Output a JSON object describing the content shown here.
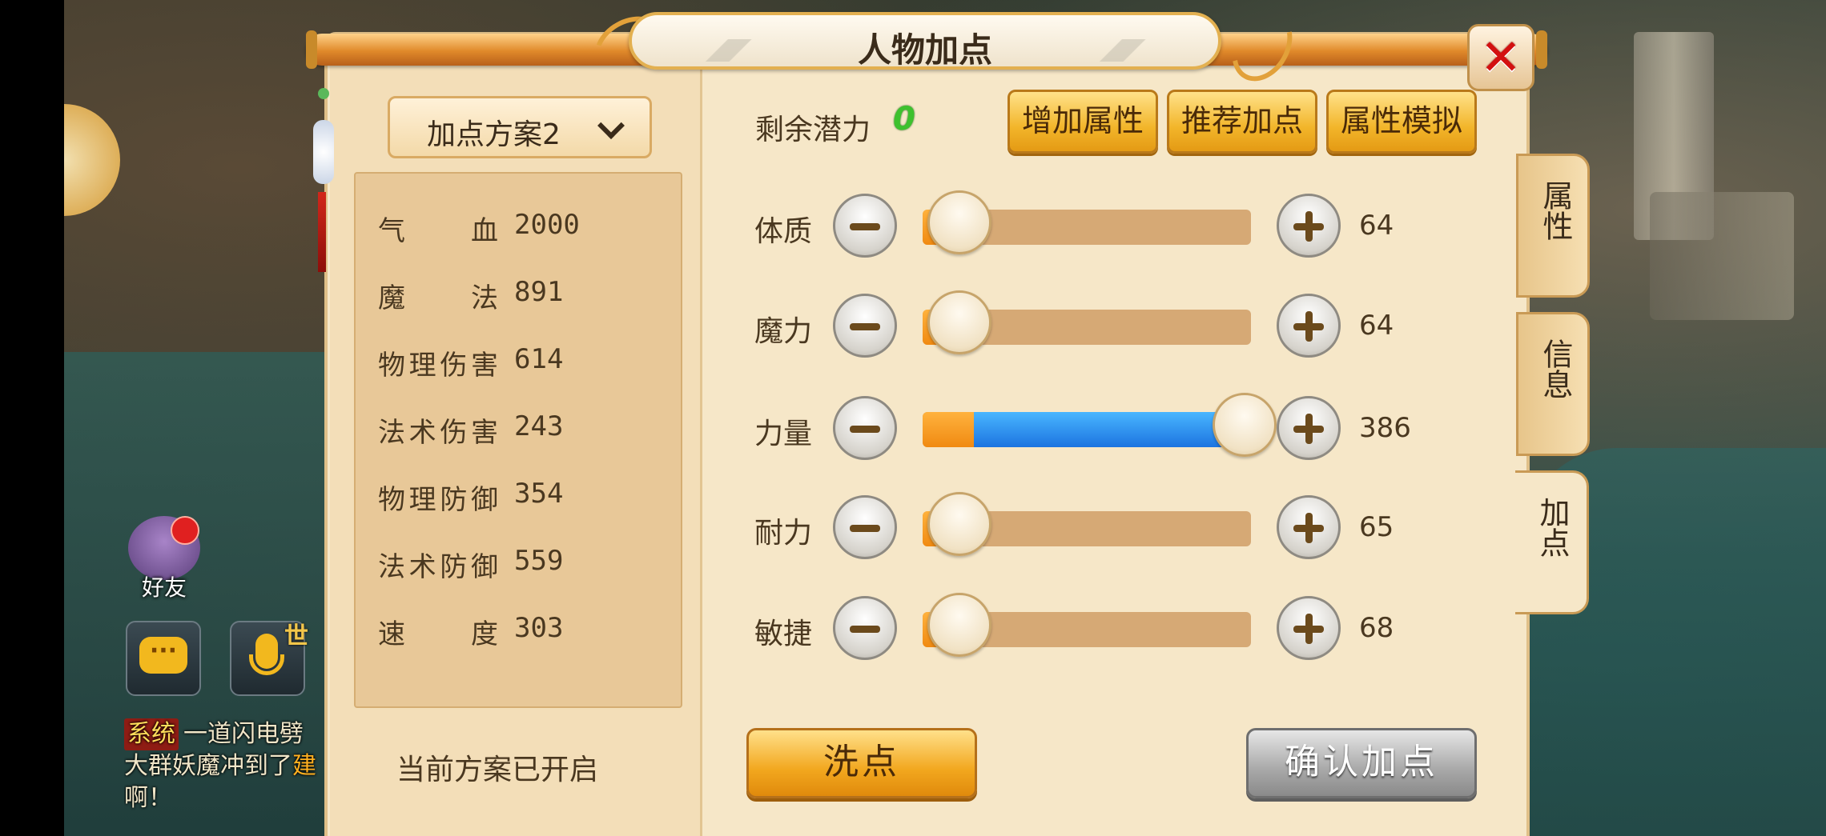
{
  "background": {
    "friend_label": "好友",
    "voice_badge": "世",
    "chat_bubble": "···",
    "chat": {
      "tag": "系统",
      "line1": "一道闪电劈",
      "line2_a": "大群妖魔冲到了",
      "line2_b": "建",
      "line3": "啊！"
    }
  },
  "window": {
    "title": "人物加点",
    "close_icon": "✕"
  },
  "left": {
    "scheme_label": "加点方案2",
    "stats": [
      {
        "label": "气　　血",
        "value": "2000"
      },
      {
        "label": "魔　　法",
        "value": "891"
      },
      {
        "label": "物理伤害",
        "value": "614"
      },
      {
        "label": "法术伤害",
        "value": "243"
      },
      {
        "label": "物理防御",
        "value": "354"
      },
      {
        "label": "法术防御",
        "value": "559"
      },
      {
        "label": "速　　度",
        "value": "303"
      }
    ],
    "status": "当前方案已开启"
  },
  "right": {
    "potential_label": "剩余潜力",
    "potential_value": "0",
    "buttons": {
      "add_attr": "增加属性",
      "recommend": "推荐加点",
      "simulate": "属性模拟"
    },
    "attributes": [
      {
        "label": "体质",
        "value": "64",
        "level": 0.0
      },
      {
        "label": "魔力",
        "value": "64",
        "level": 0.0
      },
      {
        "label": "力量",
        "value": "386",
        "level": 1.0
      },
      {
        "label": "耐力",
        "value": "65",
        "level": 0.0
      },
      {
        "label": "敏捷",
        "value": "68",
        "level": 0.0
      }
    ],
    "wash_button": "洗点",
    "confirm_button": "确认加点"
  },
  "tabs": [
    {
      "label": "属性",
      "active": false
    },
    {
      "label": "信息",
      "active": false
    },
    {
      "label": "加点",
      "active": true
    }
  ],
  "colors": {
    "accent_orange": "#f2b52a",
    "bar_blue": "#1c74e0",
    "potential_green": "#3ec12e",
    "close_red": "#d31010"
  }
}
